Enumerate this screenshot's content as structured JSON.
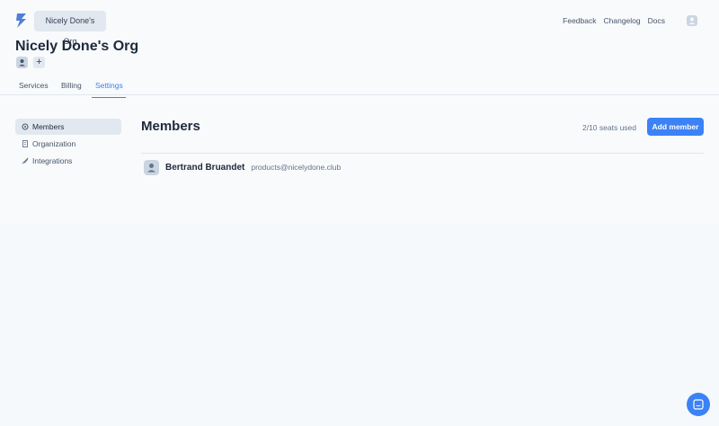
{
  "header": {
    "org_switcher_label": "Nicely Done's Org",
    "links": [
      "Feedback",
      "Changelog",
      "Docs"
    ]
  },
  "page": {
    "title": "Nicely Done's Org",
    "add_symbol": "+"
  },
  "tabs": [
    {
      "label": "Services",
      "active": false
    },
    {
      "label": "Billing",
      "active": false
    },
    {
      "label": "Settings",
      "active": true
    }
  ],
  "sidebar": {
    "items": [
      {
        "label": "Members",
        "icon": "gear-icon",
        "active": true
      },
      {
        "label": "Organization",
        "icon": "building-icon",
        "active": false
      },
      {
        "label": "Integrations",
        "icon": "feather-icon",
        "active": false
      }
    ]
  },
  "main": {
    "title": "Members",
    "seats_text": "2/10 seats used",
    "add_button_label": "Add member",
    "members": [
      {
        "name": "Bertrand Bruandet",
        "email": "products@nicelydone.club"
      }
    ]
  },
  "colors": {
    "accent": "#3b82f6",
    "background": "#f8fafc",
    "pill": "#e2e8f0"
  }
}
